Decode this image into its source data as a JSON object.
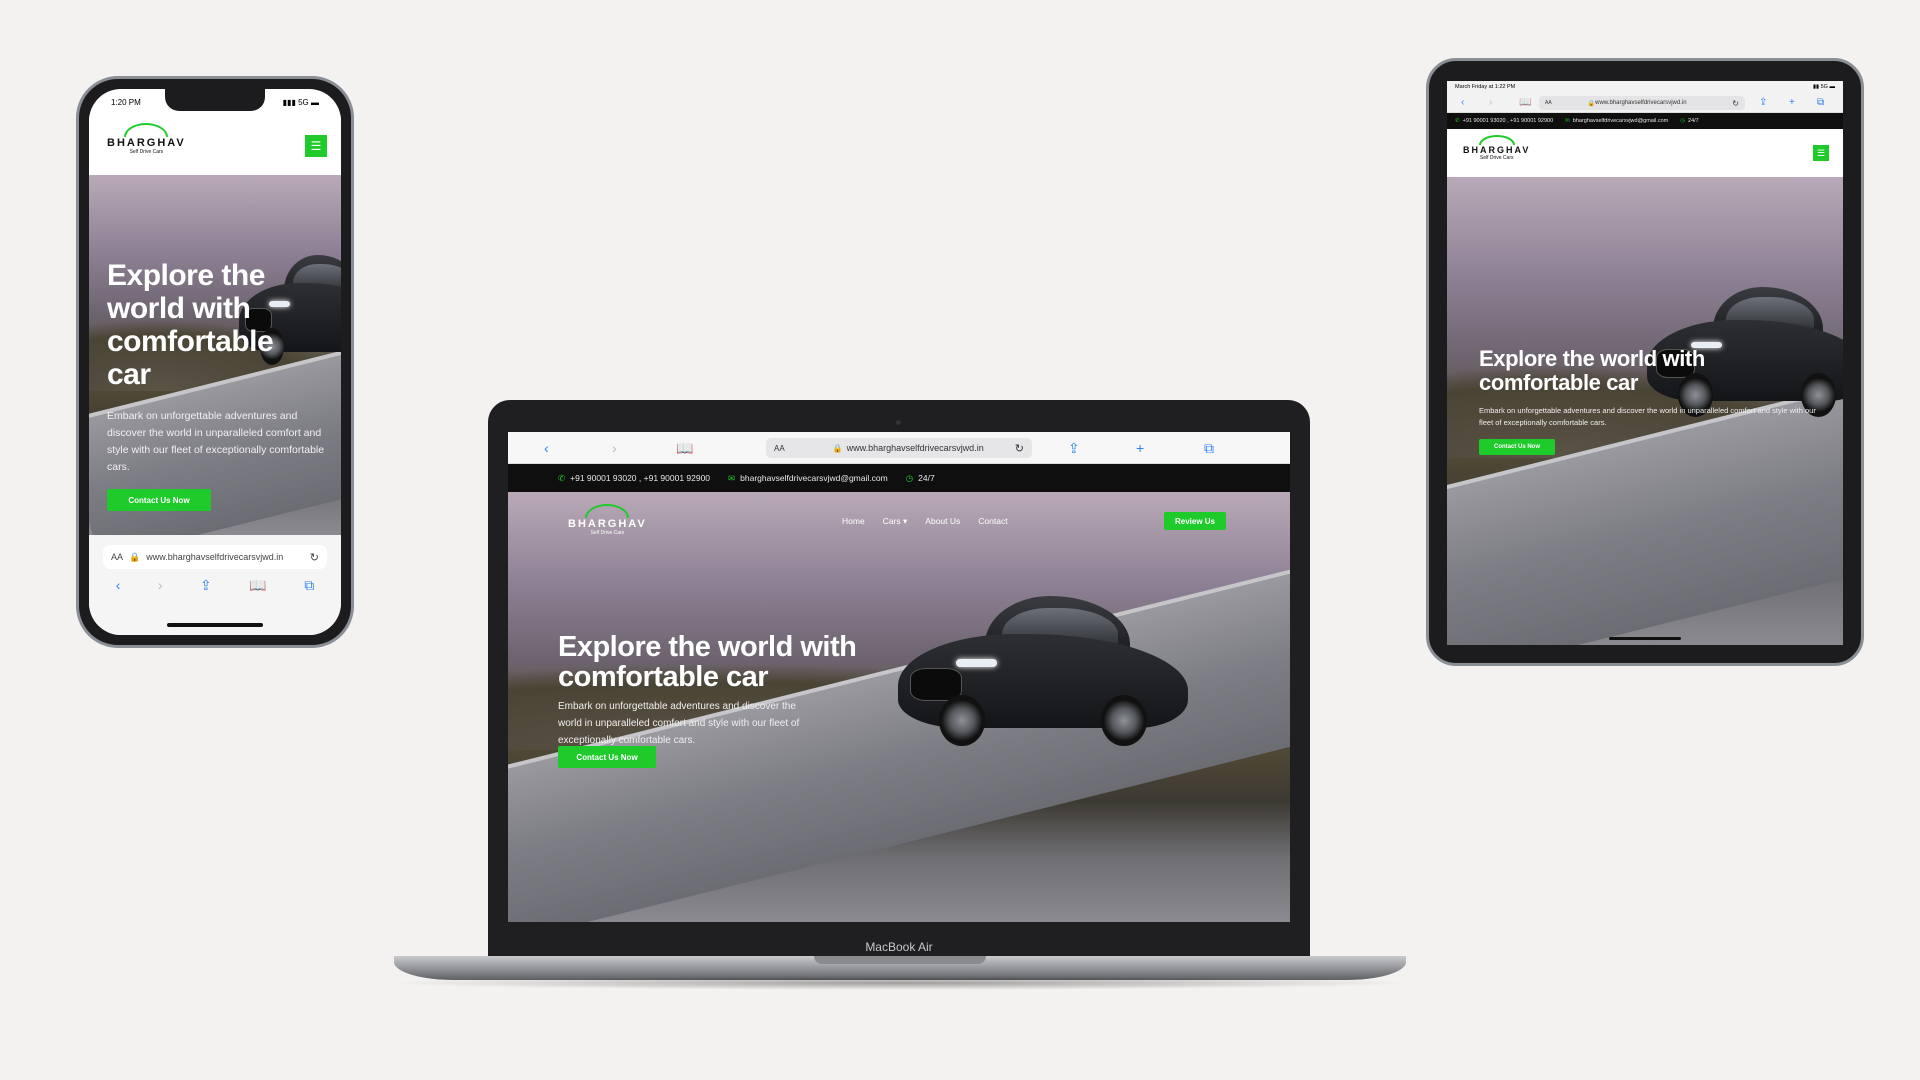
{
  "brand": {
    "name": "BHARGHAV",
    "tagline": "Self Drive Cars",
    "accent_color": "#1ecb2a"
  },
  "hero": {
    "headline": "Explore the world with comfortable car",
    "description": "Embark on unforgettable adventures and discover the world in unparalleled comfort and style with our fleet of exceptionally comfortable cars.",
    "cta_label": "Contact Us Now"
  },
  "contact_bar": {
    "phones": "+91 90001 93020 , +91 90001 92900",
    "phones_short": "+91 90001 93020 , +91 90001 92900",
    "email": "bharghavselfdrivecarsvjwd@gmail.com",
    "tablet_email": "bharghavselfdrivecarsvjwd@gmail.com",
    "hours": "24/7"
  },
  "nav": {
    "items": [
      "Home",
      "Cars",
      "About Us",
      "Contact"
    ],
    "review_label": "Review Us"
  },
  "browser": {
    "url": "www.bharghavselfdrivecarsvjwd.in",
    "url_tablet": "www.bharghavselfdrivecarsvjwd.in",
    "aa": "AA",
    "aa_phone": "AA"
  },
  "devices": {
    "laptop_label": "MacBook Air",
    "phone_time": "1:20 PM",
    "phone_signal": "5G",
    "tablet_time": "March Friday at 1:22 PM",
    "tablet_signal": "5G"
  },
  "icons": {
    "back": "chevron-left-icon",
    "forward": "chevron-right-icon",
    "bookmarks": "book-icon",
    "share": "share-icon",
    "new_tab": "plus-icon",
    "tabs": "tabs-icon",
    "reload": "reload-icon",
    "lock": "lock-icon",
    "menu": "hamburger-icon",
    "phone": "phone-icon",
    "email": "mail-icon",
    "clock": "clock-icon"
  }
}
